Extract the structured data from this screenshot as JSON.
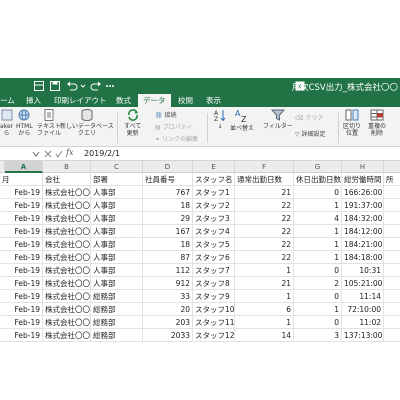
{
  "window": {
    "title": "月次CSV出力_株式会社〇〇"
  },
  "tabs": [
    {
      "label": "ーム"
    },
    {
      "label": "挿入"
    },
    {
      "label": "印刷レイアウト"
    },
    {
      "label": "数式"
    },
    {
      "label": "データ"
    },
    {
      "label": "校閲"
    },
    {
      "label": "表示"
    }
  ],
  "ribbon": {
    "from_maker_l1": "aker",
    "from_maker_l2": "ら",
    "html_l1": "HTML",
    "html_l2": "から",
    "text_l1": "テキスト",
    "text_l2": "ファイル",
    "newdb_l1": "新しいデータベース",
    "newdb_l2": "クエリ",
    "refresh_l1": "すべて",
    "refresh_l2": "更新",
    "connections": "接続",
    "properties": "プロパティ",
    "edit_links": "リンクの編集",
    "sort_az": "↓",
    "sort": "並べ替え",
    "filter": "フィルター",
    "clear": "クリア",
    "advanced": "詳細設定",
    "text_to_cols_l1": "区切り",
    "text_to_cols_l2": "位置",
    "remove_dup_l1": "重複の",
    "remove_dup_l2": "削除"
  },
  "formula_bar": {
    "fx": "fx",
    "value": "2019/2/1"
  },
  "columns": [
    "A",
    "B",
    "C",
    "D",
    "E",
    "F",
    "G",
    "H"
  ],
  "header_row": [
    "月",
    "会社",
    "部署",
    "社員番号",
    "スタッフ名",
    "通常出勤日数",
    "休日出勤日数",
    "総労働時間",
    "所"
  ],
  "rows": [
    [
      "Feb-19",
      "株式会社〇〇〇",
      "人事部",
      "767",
      "スタッフ1",
      "21",
      "0",
      "166:26:00"
    ],
    [
      "Feb-19",
      "株式会社〇〇〇",
      "人事部",
      "18",
      "スタッフ2",
      "22",
      "1",
      "191:37:00"
    ],
    [
      "Feb-19",
      "株式会社〇〇〇",
      "人事部",
      "29",
      "スタッフ3",
      "22",
      "4",
      "184:32:00"
    ],
    [
      "Feb-19",
      "株式会社〇〇〇",
      "人事部",
      "167",
      "スタッフ4",
      "22",
      "1",
      "184:12:00"
    ],
    [
      "Feb-19",
      "株式会社〇〇〇",
      "人事部",
      "18",
      "スタッフ5",
      "22",
      "1",
      "184:21:00"
    ],
    [
      "Feb-19",
      "株式会社〇〇〇",
      "人事部",
      "87",
      "スタッフ6",
      "22",
      "1",
      "184:18:00"
    ],
    [
      "Feb-19",
      "株式会社〇〇〇",
      "人事部",
      "112",
      "スタッフ7",
      "1",
      "0",
      "10:31"
    ],
    [
      "Feb-19",
      "株式会社〇〇〇",
      "人事部",
      "912",
      "スタッフ8",
      "21",
      "2",
      "105:21:00"
    ],
    [
      "Feb-19",
      "株式会社〇〇〇",
      "総務部",
      "33",
      "スタッフ9",
      "1",
      "0",
      "11:14"
    ],
    [
      "Feb-19",
      "株式会社〇〇〇",
      "総務部",
      "20",
      "スタッフ10",
      "6",
      "1",
      "72:10:00"
    ],
    [
      "Feb-19",
      "株式会社〇〇〇",
      "総務部",
      "203",
      "スタッフ11",
      "1",
      "0",
      "11:02"
    ],
    [
      "Feb-19",
      "株式会社〇〇〇",
      "総務部",
      "2033",
      "スタッフ12",
      "14",
      "3",
      "137:13:00"
    ]
  ],
  "colors": {
    "excel_green": "#217346",
    "ribbon_bg": "#f3f3f3"
  }
}
